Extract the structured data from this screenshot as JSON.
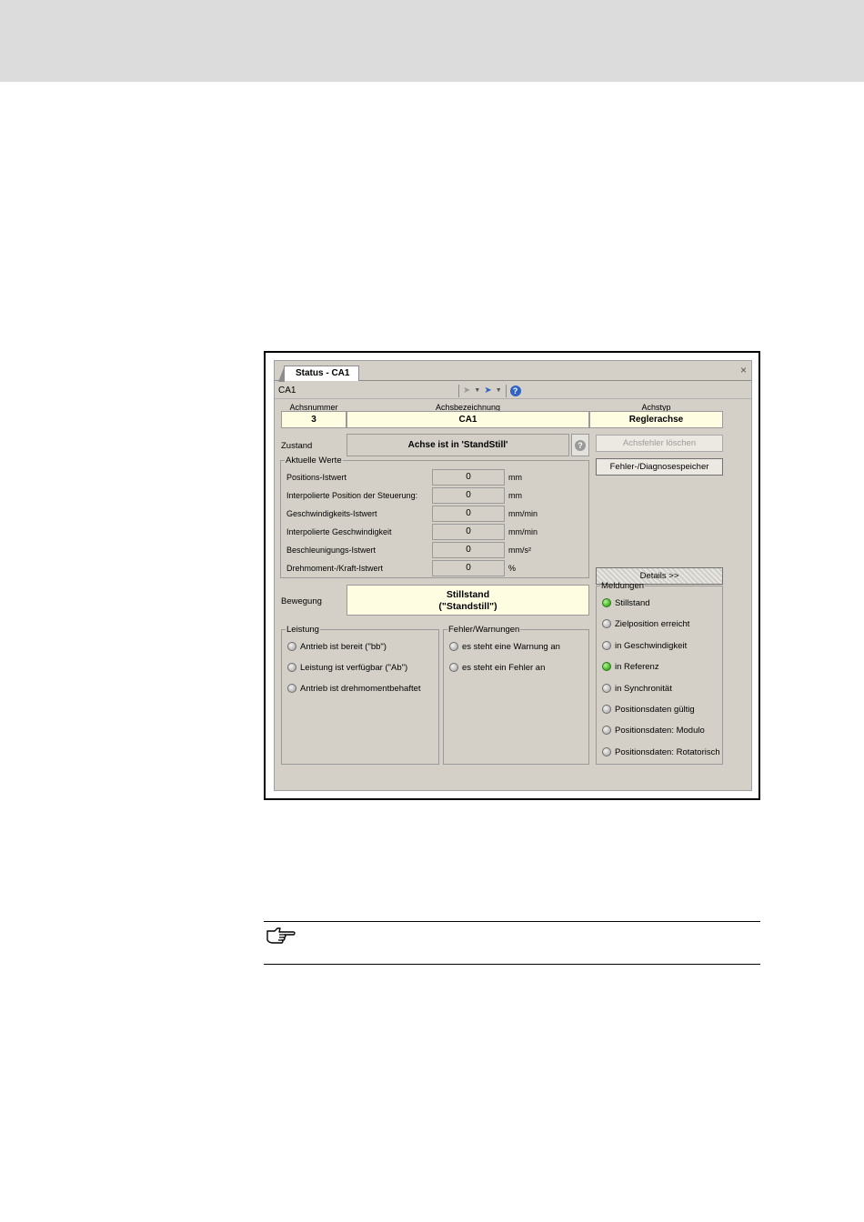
{
  "window": {
    "tab_title": "Status - CA1",
    "toolbar_title": "CA1",
    "close_glyph": "×",
    "icons": [
      "nav-back-icon",
      "nav-forward-icon",
      "help-icon"
    ]
  },
  "axis_table": {
    "headers": [
      "Achsnummer",
      "Achsbezeichnung",
      "Achstyp"
    ],
    "values": [
      "3",
      "CA1",
      "Reglerachse"
    ]
  },
  "zustand": {
    "label": "Zustand",
    "value": "Achse ist in 'StandStill'"
  },
  "buttons": {
    "clear_axis_error": "Achsfehler löschen",
    "error_memory": "Fehler-/Diagnosespeicher",
    "details": "Details >>"
  },
  "current_values": {
    "legend": "Aktuelle Werte",
    "rows": [
      {
        "label": "Positions-Istwert",
        "value": "0",
        "unit": "mm"
      },
      {
        "label": "Interpolierte Position der Steuerung:",
        "value": "0",
        "unit": "mm"
      },
      {
        "label": "Geschwindigkeits-Istwert",
        "value": "0",
        "unit": "mm/min"
      },
      {
        "label": "Interpolierte Geschwindigkeit",
        "value": "0",
        "unit": "mm/min"
      },
      {
        "label": "Beschleunigungs-Istwert",
        "value": "0",
        "unit": "mm/s²"
      },
      {
        "label": "Drehmoment-/Kraft-Istwert",
        "value": "0",
        "unit": "%"
      }
    ]
  },
  "bewegung": {
    "label": "Bewegung",
    "line1": "Stillstand",
    "line2": "(\"Standstill\")"
  },
  "leistung": {
    "legend": "Leistung",
    "items": [
      {
        "label": "Antrieb ist bereit (\"bb\")",
        "on": false
      },
      {
        "label": "Leistung ist verfügbar (\"Ab\")",
        "on": false
      },
      {
        "label": "Antrieb ist drehmomentbehaftet",
        "on": false
      }
    ]
  },
  "fehler": {
    "legend": "Fehler/Warnungen",
    "items": [
      {
        "label": "es steht eine Warnung an",
        "on": false
      },
      {
        "label": "es steht ein Fehler an",
        "on": false
      }
    ]
  },
  "meldungen": {
    "legend": "Meldungen",
    "items": [
      {
        "label": "Stillstand",
        "on": true
      },
      {
        "label": "Zielposition erreicht",
        "on": false
      },
      {
        "label": "in Geschwindigkeit",
        "on": false
      },
      {
        "label": "in Referenz",
        "on": true
      },
      {
        "label": "in Synchronität",
        "on": false
      },
      {
        "label": "Positionsdaten gültig",
        "on": false
      },
      {
        "label": "Positionsdaten: Modulo",
        "on": false
      },
      {
        "label": "Positionsdaten: Rotatorisch",
        "on": false
      }
    ]
  },
  "colors": {
    "led_on": "#3cb020",
    "field_yellow": "#fffde1",
    "window_gray": "#d4d0c8"
  },
  "note": {
    "icon": "pointing-hand-icon"
  }
}
